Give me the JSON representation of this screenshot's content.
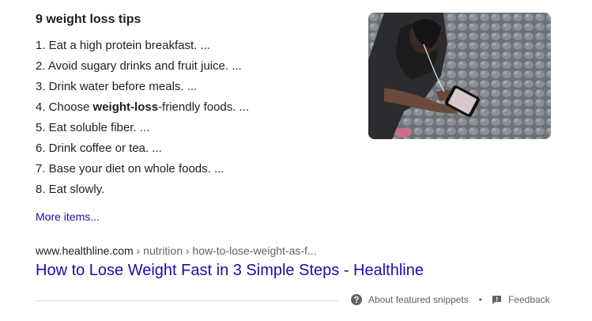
{
  "snippet": {
    "title": "9 weight loss tips",
    "items": [
      {
        "pre": "1. Eat a high protein breakfast. ...",
        "bold": "",
        "post": ""
      },
      {
        "pre": "2. Avoid sugary drinks and fruit juice. ...",
        "bold": "",
        "post": ""
      },
      {
        "pre": "3. Drink water before meals. ...",
        "bold": "",
        "post": ""
      },
      {
        "pre": "4. Choose ",
        "bold": "weight-loss",
        "post": "-friendly foods. ..."
      },
      {
        "pre": "5. Eat soluble fiber. ...",
        "bold": "",
        "post": ""
      },
      {
        "pre": "6. Drink coffee or tea. ...",
        "bold": "",
        "post": ""
      },
      {
        "pre": "7. Base your diet on whole foods. ...",
        "bold": "",
        "post": ""
      },
      {
        "pre": "8. Eat slowly.",
        "bold": "",
        "post": ""
      }
    ],
    "more_items": "More items..."
  },
  "result": {
    "domain": "www.healthline.com",
    "path": " › nutrition › how-to-lose-weight-as-f...",
    "title": "How to Lose Weight Fast in 3 Simple Steps - Healthline"
  },
  "footer": {
    "about": "About featured snippets",
    "separator": "•",
    "feedback": "Feedback"
  },
  "colors": {
    "link": "#1a0dab",
    "text": "#202124",
    "muted": "#5f6368"
  },
  "icons": {
    "about": "question-circle-icon",
    "feedback": "feedback-flag-icon"
  }
}
